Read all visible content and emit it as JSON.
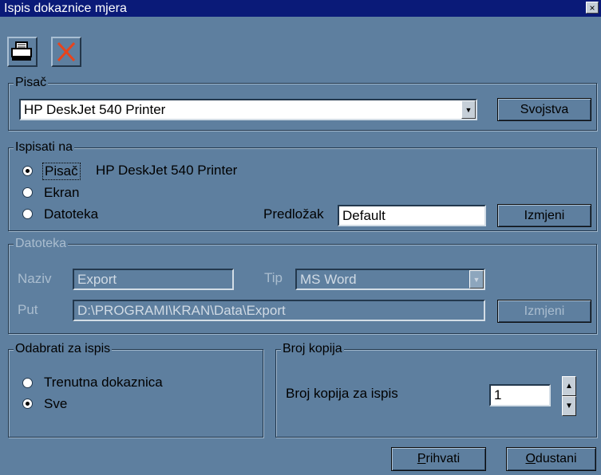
{
  "window": {
    "title": "Ispis dokaznice mjera",
    "close_icon": "×"
  },
  "toolbar": {
    "print_icon": "printer-icon",
    "cancel_icon": "x-icon",
    "cancel_color": "#e8441c"
  },
  "printer_group": {
    "legend": "Pisač",
    "selected_printer": "HP DeskJet 540 Printer",
    "properties_button": "Svojstva"
  },
  "output_group": {
    "legend": "Ispisati na",
    "options": [
      {
        "label": "Pisač",
        "selected": true,
        "detail": "HP DeskJet 540 Printer"
      },
      {
        "label": "Ekran",
        "selected": false
      },
      {
        "label": "Datoteka",
        "selected": false
      }
    ],
    "template_label": "Predložak",
    "template_value": "Default",
    "change_button": "Izmjeni"
  },
  "file_group": {
    "legend": "Datoteka",
    "name_label": "Naziv",
    "name_value": "Export",
    "type_label": "Tip",
    "type_value": "MS Word",
    "path_label": "Put",
    "path_value": "D:\\PROGRAMI\\KRAN\\Data\\Export",
    "change_button": "Izmjeni"
  },
  "select_group": {
    "legend": "Odabrati za ispis",
    "options": [
      {
        "label": "Trenutna dokaznica",
        "selected": false
      },
      {
        "label": "Sve",
        "selected": true
      }
    ]
  },
  "copies_group": {
    "legend": "Broj kopija",
    "label": "Broj kopija za ispis",
    "value": "1"
  },
  "footer": {
    "accept_button": {
      "underlined": "P",
      "rest": "rihvati"
    },
    "cancel_button": {
      "underlined": "O",
      "rest": "dustani"
    }
  }
}
